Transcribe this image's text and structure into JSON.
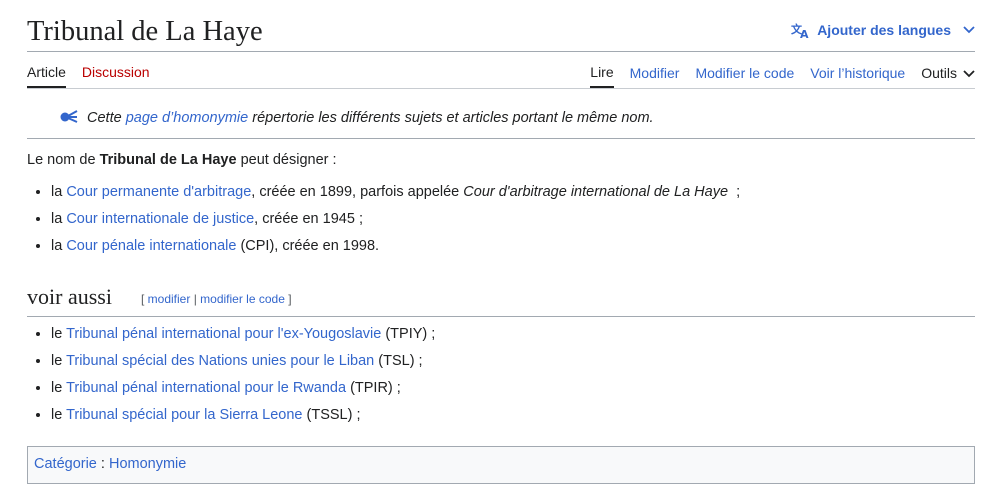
{
  "header": {
    "title": "Tribunal de La Haye",
    "lang_button": "Ajouter des langues"
  },
  "tabs": {
    "left": [
      {
        "label": "Article"
      },
      {
        "label": "Discussion"
      }
    ],
    "right": [
      {
        "label": "Lire"
      },
      {
        "label": "Modifier"
      },
      {
        "label": "Modifier le code"
      },
      {
        "label": "Voir l’historique"
      },
      {
        "label": "Outils"
      }
    ]
  },
  "hatnote": {
    "prefix": "Cette ",
    "link": "page d’homonymie",
    "suffix": " répertorie les différents sujets et articles portant le même nom."
  },
  "intro": {
    "prefix": "Le nom de ",
    "bold": "Tribunal de La Haye",
    "suffix": " peut désigner :"
  },
  "items": [
    {
      "pre": "la ",
      "link": "Cour permanente d'arbitrage",
      "mid": ", créée en 1899, parfois appelée ",
      "italic": "Cour d'arbitrage international de La Haye",
      "post": "  ;"
    },
    {
      "pre": "la ",
      "link": "Cour internationale de justice",
      "post": ", créée en 1945 ;"
    },
    {
      "pre": "la ",
      "link": "Cour pénale internationale",
      "post": " (CPI), créée en 1998."
    }
  ],
  "section": {
    "title": "voir aussi",
    "edit_open": "[ ",
    "edit": "modifier",
    "sep": " | ",
    "edit_code": "modifier le code",
    "edit_close": " ]"
  },
  "see_also": [
    {
      "pre": "le ",
      "link": "Tribunal pénal international pour l'ex-Yougoslavie",
      "post": " (TPIY) ;"
    },
    {
      "pre": "le ",
      "link": "Tribunal spécial des Nations unies pour le Liban",
      "post": " (TSL) ;"
    },
    {
      "pre": "le ",
      "link": "Tribunal pénal international pour le Rwanda",
      "post": " (TPIR) ;"
    },
    {
      "pre": "le ",
      "link": "Tribunal spécial pour la Sierra Leone",
      "post": " (TSSL) ;"
    }
  ],
  "categories": {
    "label": "Catégorie",
    "sep": " : ",
    "items": [
      "Homonymie"
    ]
  },
  "icons": {
    "language": "translate-icon",
    "chevron": "chevron-down-icon",
    "disambiguation": "disambiguation-icon"
  },
  "colors": {
    "link": "#3366cc",
    "new_link": "#ba0000",
    "text": "#202122",
    "border": "#a2a9b1"
  }
}
